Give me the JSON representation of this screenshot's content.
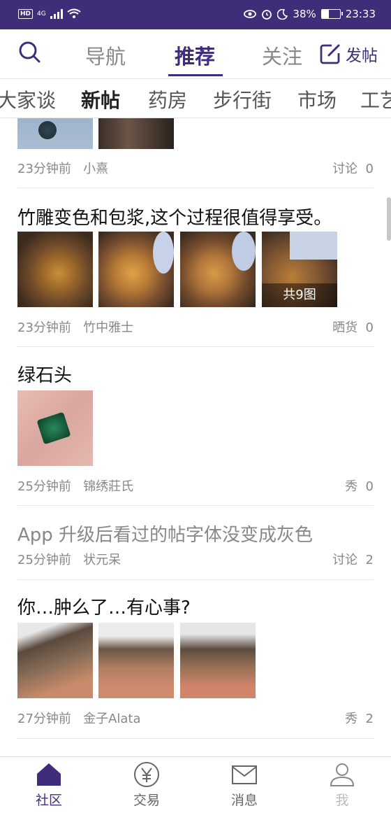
{
  "status": {
    "hd": "HD",
    "network": "4G",
    "battery": "38%",
    "time": "23:33"
  },
  "nav": {
    "tabs": [
      "导航",
      "推荐",
      "关注"
    ],
    "post_label": "发帖"
  },
  "subnav": [
    "大家谈",
    "新帖",
    "药房",
    "步行街",
    "市场",
    "工艺"
  ],
  "posts": [
    {
      "time": "23分钟前",
      "author": "小熹",
      "category": "讨论",
      "count": "0"
    },
    {
      "title": "竹雕变色和包浆,这个过程很值得享受。",
      "time": "23分钟前",
      "author": "竹中雅士",
      "category": "晒货",
      "count": "0",
      "badge": "共9图"
    },
    {
      "title": "绿石头",
      "time": "25分钟前",
      "author": "锦绣莊氏",
      "category": "秀",
      "count": "0"
    },
    {
      "title": "App 升级后看过的帖字体没变成灰色",
      "time": "25分钟前",
      "author": "状元呆",
      "category": "讨论",
      "count": "2"
    },
    {
      "title": "你…肿么了…有心事?",
      "time": "27分钟前",
      "author": "金子Alata",
      "category": "秀",
      "count": "2"
    }
  ],
  "bottom": [
    "社区",
    "交易",
    "消息",
    "我"
  ],
  "colors": {
    "accent": "#3f2d7a"
  }
}
